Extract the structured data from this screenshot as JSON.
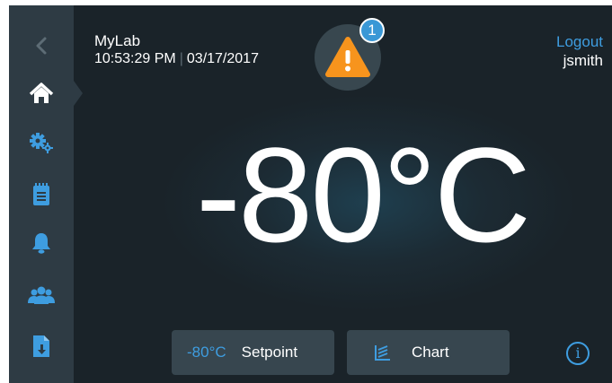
{
  "colors": {
    "accent": "#3e9de0",
    "warning": "#f7941d",
    "sidebar": "#2e3b44",
    "background": "#1c2b34",
    "button": "#37464f"
  },
  "sidebar": {
    "items": [
      {
        "icon": "back-chevron-icon"
      },
      {
        "icon": "home-icon",
        "active": true
      },
      {
        "icon": "settings-gears-icon"
      },
      {
        "icon": "clipboard-log-icon"
      },
      {
        "icon": "bell-alarm-icon"
      },
      {
        "icon": "users-group-icon"
      },
      {
        "icon": "document-download-icon"
      }
    ]
  },
  "header": {
    "app_name": "MyLab",
    "time": "10:53:29 PM",
    "separator": "|",
    "date": "03/17/2017"
  },
  "alert": {
    "icon": "warning-triangle-icon",
    "badge_count": "1"
  },
  "user": {
    "logout_label": "Logout",
    "username": "jsmith"
  },
  "main": {
    "temperature": "-80°C"
  },
  "buttons": {
    "setpoint_value": "-80°C",
    "setpoint_label": "Setpoint",
    "chart_label": "Chart",
    "chart_icon": "chart-icon",
    "info_icon": "info-icon",
    "info_glyph": "i"
  }
}
